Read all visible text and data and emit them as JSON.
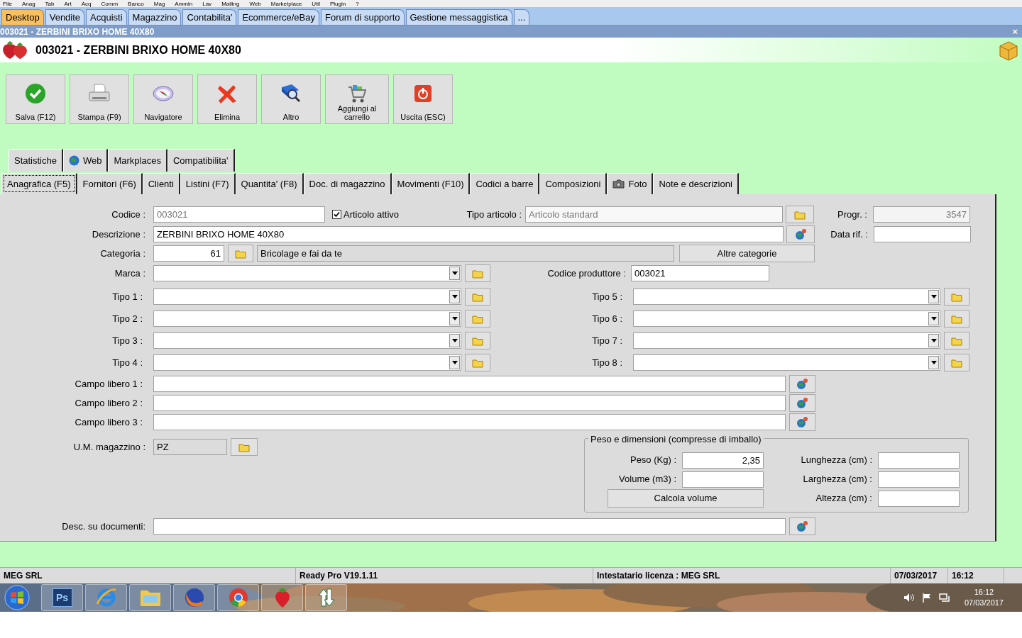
{
  "menu": [
    "File",
    "Anag",
    "Tab",
    "Art",
    "Acq",
    "Comm",
    "Banco",
    "Mag",
    "Ammin",
    "Lav",
    "Mailing",
    "Web",
    "Marketplace",
    "Util",
    "Plugin",
    "?"
  ],
  "app_tabs": [
    {
      "label": "Desktop",
      "selected": true
    },
    {
      "label": "Vendite",
      "selected": false
    },
    {
      "label": "Acquisti",
      "selected": false
    },
    {
      "label": "Magazzino",
      "selected": false
    },
    {
      "label": "Contabilita'",
      "selected": false
    },
    {
      "label": "Ecommerce/eBay",
      "selected": false
    },
    {
      "label": "Forum di supporto",
      "selected": false
    },
    {
      "label": "Gestione messaggistica",
      "selected": false
    },
    {
      "label": "...",
      "selected": false
    }
  ],
  "window": {
    "title": "003021 - ZERBINI BRIXO HOME 40X80",
    "close": "×"
  },
  "header": {
    "title": "003021 - ZERBINI BRIXO HOME 40X80"
  },
  "toolbar": [
    {
      "label": "Salva (F12)",
      "kind": "check"
    },
    {
      "label": "Stampa (F9)",
      "kind": "printer"
    },
    {
      "label": "Navigatore",
      "kind": "compass"
    },
    {
      "label": "Elimina",
      "kind": "cross"
    },
    {
      "label": "Altro",
      "kind": "book"
    },
    {
      "label": "Aggiungi al carrello",
      "kind": "cart"
    },
    {
      "label": "Uscita (ESC)",
      "kind": "power"
    }
  ],
  "tabs_upper": [
    {
      "label": "Statistiche",
      "kind": "text",
      "selected": false
    },
    {
      "label": "Web",
      "kind": "globe",
      "selected": false
    },
    {
      "label": "Markplaces",
      "kind": "text",
      "selected": false
    },
    {
      "label": "Compatibilita'",
      "kind": "text",
      "selected": false
    }
  ],
  "tabs_lower": [
    {
      "label": "Anagrafica (F5)",
      "kind": "text",
      "selected": true
    },
    {
      "label": "Fornitori (F6)",
      "kind": "text",
      "selected": false
    },
    {
      "label": "Clienti",
      "kind": "text",
      "selected": false
    },
    {
      "label": "Listini (F7)",
      "kind": "text",
      "selected": false
    },
    {
      "label": "Quantita' (F8)",
      "kind": "text",
      "selected": false
    },
    {
      "label": "Doc. di magazzino",
      "kind": "text",
      "selected": false
    },
    {
      "label": "Movimenti (F10)",
      "kind": "text",
      "selected": false
    },
    {
      "label": "Codici a barre",
      "kind": "text",
      "selected": false
    },
    {
      "label": "Composizioni",
      "kind": "text",
      "selected": false
    },
    {
      "label": "Foto",
      "kind": "camera",
      "selected": false
    },
    {
      "label": "Note e descrizioni",
      "kind": "text",
      "selected": false
    }
  ],
  "form": {
    "codice": {
      "label": "Codice :",
      "value": "003021"
    },
    "articolo_attivo": {
      "label": "Articolo attivo",
      "checked": true
    },
    "tipo_articolo": {
      "label": "Tipo articolo :",
      "value": "Articolo standard"
    },
    "progr": {
      "label": "Progr. :",
      "value": "3547"
    },
    "descrizione": {
      "label": "Descrizione :",
      "value": "ZERBINI BRIXO HOME 40X80"
    },
    "data_rif": {
      "label": "Data rif. :"
    },
    "categoria": {
      "label": "Categoria :",
      "code": "61",
      "name": "Bricolage e fai da te"
    },
    "altre_categorie_button": "Altre categorie",
    "marca": {
      "label": "Marca :"
    },
    "codice_produttore": {
      "label": "Codice produttore :",
      "value": "003021"
    },
    "tipi": [
      "Tipo 1 :",
      "Tipo 2 :",
      "Tipo 3 :",
      "Tipo 4 :",
      "Tipo 5 :",
      "Tipo 6 :",
      "Tipo 7 :",
      "Tipo 8 :"
    ],
    "campi_liberi": [
      "Campo libero 1 :",
      "Campo libero 2 :",
      "Campo libero 3 :"
    ],
    "um_magazzino": {
      "label": "U.M. magazzino :",
      "value": "PZ"
    },
    "dimensioni": {
      "title": "Peso e dimensioni (compresse di imballo)",
      "peso": {
        "label": "Peso (Kg) :",
        "value": "2,35"
      },
      "volume": {
        "label": "Volume (m3) :"
      },
      "calcola_button": "Calcola volume",
      "lunghezza": {
        "label": "Lunghezza (cm) :"
      },
      "larghezza": {
        "label": "Larghezza (cm) :"
      },
      "altezza": {
        "label": "Altezza (cm) :"
      }
    },
    "desc_documenti": {
      "label": "Desc. su documenti:"
    }
  },
  "status_bar": [
    "MEG SRL",
    "Ready Pro V19.1.11",
    "Intestatario licenza : MEG SRL",
    "07/03/2017",
    "16:12"
  ],
  "taskbar": {
    "apps": [
      {
        "kind": "photoshop",
        "label": "Ps"
      },
      {
        "kind": "browser-e"
      },
      {
        "kind": "folder"
      },
      {
        "kind": "fox"
      },
      {
        "kind": "chrome"
      },
      {
        "kind": "strawberry"
      },
      {
        "kind": "arrows"
      }
    ],
    "clock_time": "16:12",
    "clock_date": "07/03/2017"
  }
}
